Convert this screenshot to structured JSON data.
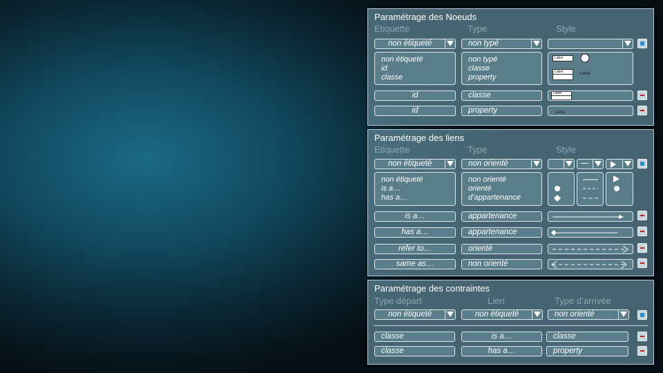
{
  "nodes": {
    "title": "Paramétrage des Noeuds",
    "headers": {
      "label": "Etiquette",
      "type": "Type",
      "style": "Style"
    },
    "selectors": {
      "label": "non étiqueté",
      "type": "non typé"
    },
    "label_options": [
      "non étiqueté",
      "id",
      "classe"
    ],
    "type_options": [
      "non typé",
      "classe",
      "property"
    ],
    "style_preview_text": "Label",
    "rows": [
      {
        "label": "id",
        "type": "classe",
        "style_text": "Label"
      },
      {
        "label": "id",
        "type": "property",
        "style_text": "Label"
      }
    ]
  },
  "links": {
    "title": "Paramétrage des liens",
    "headers": {
      "label": "Etiquette",
      "type": "Type",
      "style": "Style"
    },
    "selectors": {
      "label": "non étiqueté",
      "type": "non orienté"
    },
    "label_options": [
      "non étiqueté",
      "is a…",
      "has a…"
    ],
    "type_options": [
      "non orienté",
      "orienté",
      "d’appartenance"
    ],
    "rows": [
      {
        "label": "is a…",
        "type": "appartenance"
      },
      {
        "label": "has a…",
        "type": "appartenance"
      },
      {
        "label": "refer to…",
        "type": "orienté"
      },
      {
        "label": "same as…",
        "type": "non orienté"
      }
    ]
  },
  "constraints": {
    "title": "Paramétrage des contraintes",
    "headers": {
      "start": "Type départ",
      "link": "Lien",
      "end": "Type d’arrivée"
    },
    "selectors": {
      "start": "non étiqueté",
      "link": "non étiqueté",
      "end": "non orienté"
    },
    "rows": [
      {
        "start": "classe",
        "link": "is a…",
        "end": "classe"
      },
      {
        "start": "classe",
        "link": "has a…",
        "end": "property"
      }
    ]
  },
  "colors": {
    "panel": "#5f8796",
    "field": "#5a7d8a",
    "add": "#2a8fd0",
    "remove": "#c51a1a"
  },
  "icons": {
    "add": "plus-icon",
    "remove": "minus-icon",
    "dropdown": "triangle-down-icon"
  }
}
